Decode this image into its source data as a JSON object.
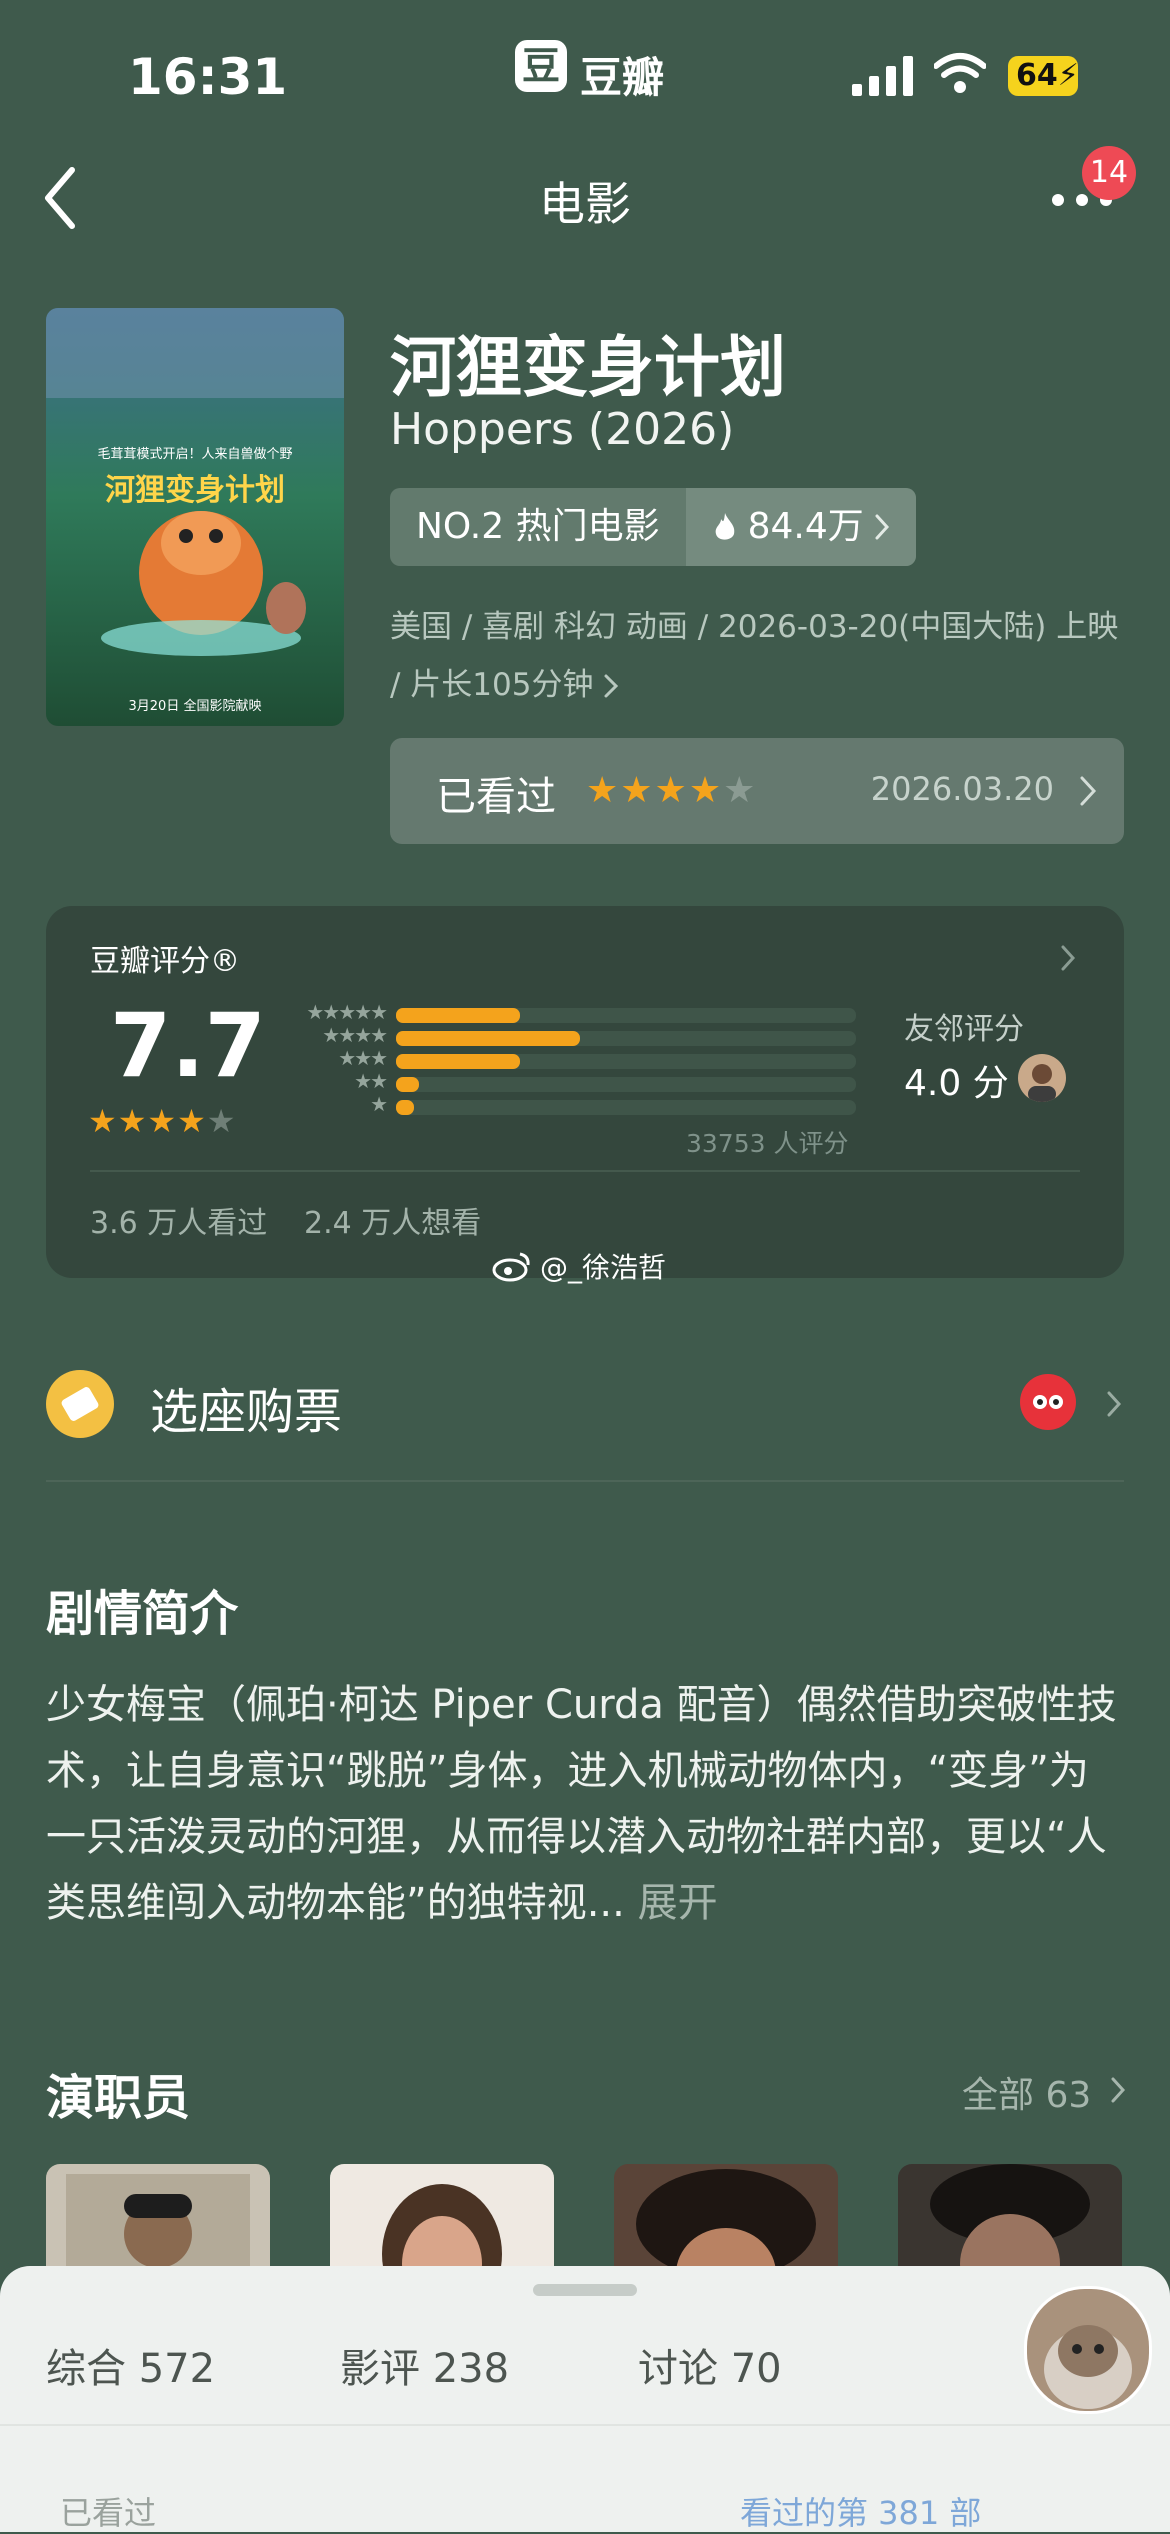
{
  "status_bar": {
    "time": "16:31",
    "app_name": "豆瓣",
    "battery": "64"
  },
  "nav": {
    "title": "电影",
    "badge": "14"
  },
  "movie": {
    "title": "河狸变身计划",
    "subtitle": "Hoppers (2026)",
    "rank": "NO.2 热门电影",
    "heat": "84.4万",
    "meta": "美国 / 喜剧 科幻 动画 / 2026-03-20(中国大陆) 上映 / 片长105分钟",
    "poster_tagline": "毛茸茸模式开启！人来自兽做个野",
    "poster_title": "河狸变身计划",
    "poster_date": "3月20日 全国影院献映"
  },
  "watched": {
    "label": "已看过",
    "stars": "★★★★",
    "stars_empty": "★",
    "date": "2026.03.20"
  },
  "rating": {
    "label": "豆瓣评分®",
    "score": "7.7",
    "stars": "★★★★",
    "stars_empty": "★",
    "distribution": [
      {
        "stars": "★★★★★",
        "fraction": 0.27
      },
      {
        "stars": "★★★★",
        "fraction": 0.4
      },
      {
        "stars": "★★★",
        "fraction": 0.27
      },
      {
        "stars": "★★",
        "fraction": 0.05
      },
      {
        "stars": "★",
        "fraction": 0.04
      }
    ],
    "count": "33753 人评分",
    "friend_label": "友邻评分",
    "friend_score": "4.0 分",
    "seen": "3.6 万人看过",
    "want": "2.4 万人想看",
    "watermark": "@_徐浩哲"
  },
  "buy": {
    "label": "选座购票"
  },
  "synopsis": {
    "title": "剧情简介",
    "body": "少女梅宝（佩珀·柯达 Piper Curda 配音）偶然借助突破性技术，让自身意识“跳脱”身体，进入机械动物体内，“变身”为一只活泼灵动的河狸，从而得以潜入动物社群内部，更以“人类思维闯入动物本能”的独特视...",
    "expand": "展开"
  },
  "cast": {
    "title": "演职员",
    "all": "全部 63"
  },
  "sheet": {
    "tabs": [
      "综合 572",
      "影评 238",
      "讨论 70"
    ],
    "peek_left": "已看过",
    "peek_right": "看过的第 381 部"
  },
  "colors": {
    "background": "#3f5a4c",
    "accent_star": "#f4a31c",
    "badge": "#ee4a55"
  }
}
